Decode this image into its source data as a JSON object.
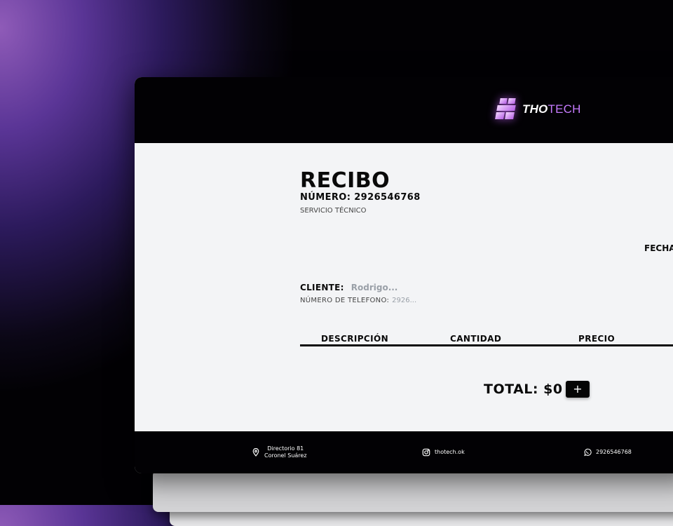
{
  "brand": {
    "name_part1": "THO",
    "name_part2": "TECH",
    "accent": "#c67bff"
  },
  "receipt": {
    "title": "RECIBO",
    "number_label": "NÚMERO: 2926546768",
    "service": "SERVICIO TÉCNICO",
    "date_label": "FECHA"
  },
  "client": {
    "label": "CLIENTE:",
    "name_placeholder": "Rodrigo...",
    "phone_label": "NÚMERO DE TELEFONO:",
    "phone_placeholder": "2926..."
  },
  "table": {
    "columns": [
      "DESCRIPCIÓN",
      "CANTIDAD",
      "PRECIO"
    ]
  },
  "summary": {
    "total_label": "TOTAL: $0",
    "add_button": "+"
  },
  "footer": {
    "address_line1": "Directorio 81",
    "address_line2": "Coronel Suárez",
    "instagram": "thotech.ok",
    "whatsapp": "2926546768",
    "icons": [
      "location-icon",
      "instagram-icon",
      "whatsapp-icon"
    ]
  }
}
